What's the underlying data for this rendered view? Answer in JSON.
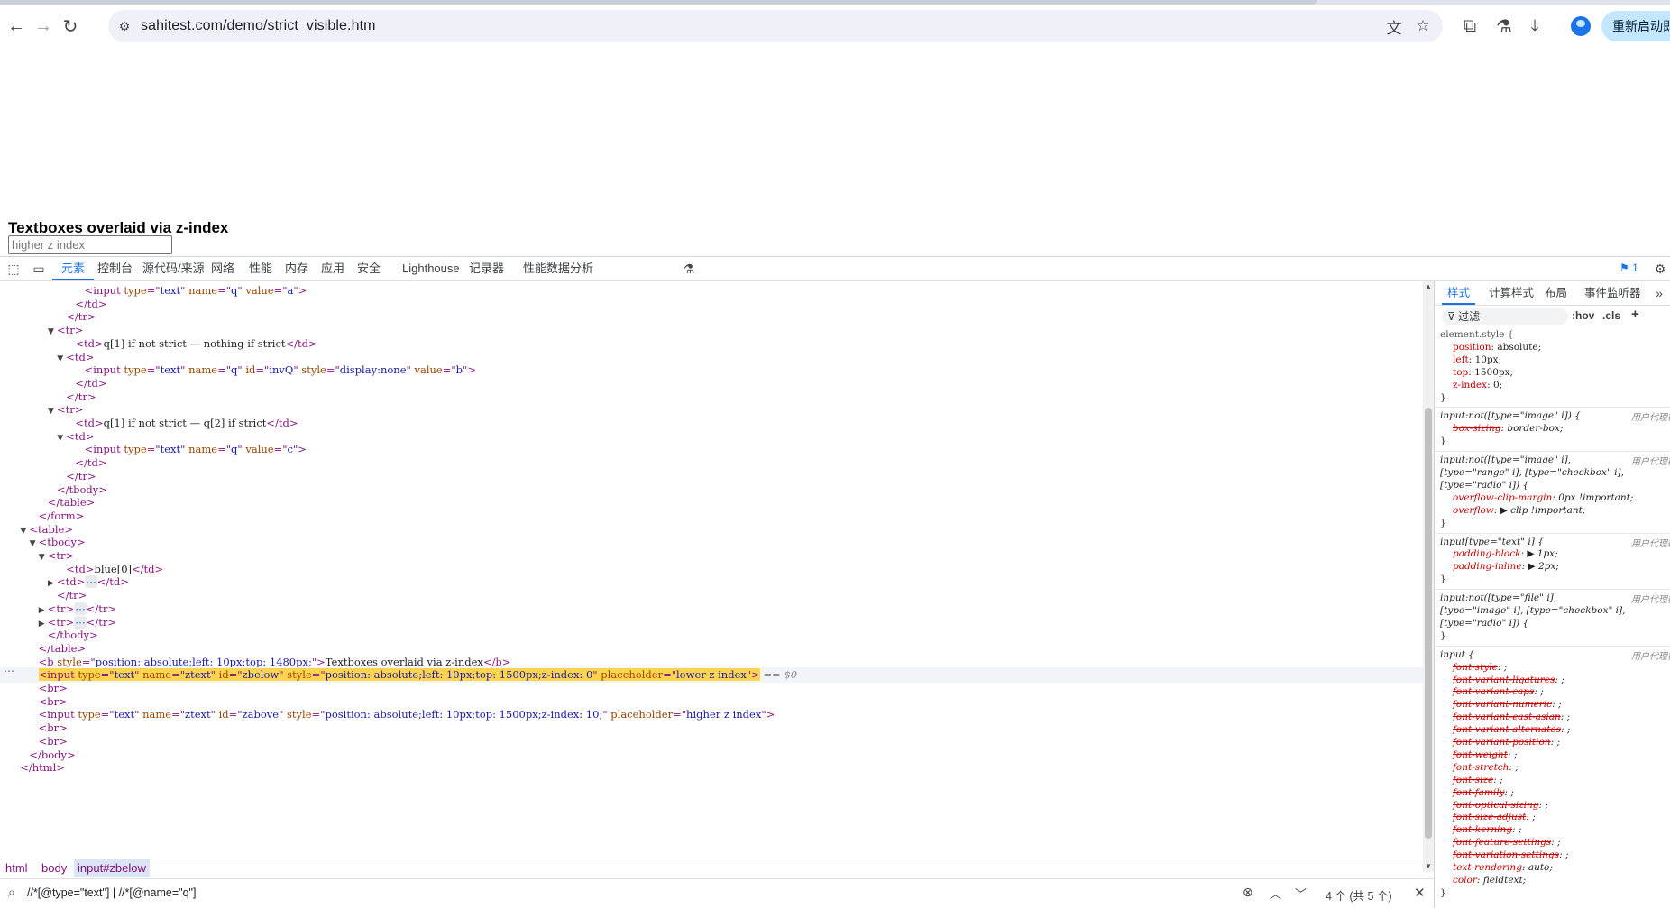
{
  "browser": {
    "url": "sahitest.com/demo/strict_visible.htm",
    "relaunch_label": "重新启动即可更新",
    "icons": {
      "back": "arrow-left-icon",
      "forward": "arrow-right-icon",
      "reload": "reload-icon",
      "site_info": "tune-icon",
      "translate": "translate-icon",
      "bookmark": "star-icon",
      "extensions": "puzzle-icon",
      "labs": "flask-icon",
      "downloads": "download-icon",
      "profile": "avatar-icon"
    }
  },
  "page": {
    "heading": "Textboxes overlaid via z-index",
    "input_placeholder": "higher z index"
  },
  "devtools": {
    "tabs": [
      "元素",
      "控制台",
      "源代码/来源",
      "网络",
      "性能",
      "内存",
      "应用",
      "安全",
      "Lighthouse",
      "记录器",
      "性能数据分析"
    ],
    "active_tab": "元素",
    "message_count": "1",
    "dom_lines": [
      {
        "indent": 8,
        "tri": "",
        "parts": [
          [
            "t",
            "<input "
          ],
          [
            "a",
            "type"
          ],
          [
            "t",
            "=\""
          ],
          [
            "v",
            "text"
          ],
          [
            "t",
            "\" "
          ],
          [
            "a",
            "name"
          ],
          [
            "t",
            "=\""
          ],
          [
            "v",
            "q"
          ],
          [
            "t",
            "\" "
          ],
          [
            "a",
            "value"
          ],
          [
            "t",
            "=\""
          ],
          [
            "v",
            "a"
          ],
          [
            "t",
            "\">"
          ]
        ]
      },
      {
        "indent": 7,
        "tri": "",
        "parts": [
          [
            "t",
            "</td>"
          ]
        ]
      },
      {
        "indent": 6,
        "tri": "",
        "parts": [
          [
            "t",
            "</tr>"
          ]
        ]
      },
      {
        "indent": 5,
        "tri": "▼",
        "parts": [
          [
            "t",
            "<tr>"
          ]
        ]
      },
      {
        "indent": 7,
        "tri": "",
        "parts": [
          [
            "t",
            "<td>"
          ],
          [
            "x",
            "q[1] if not strict — nothing if strict"
          ],
          [
            "t",
            "</td>"
          ]
        ]
      },
      {
        "indent": 6,
        "tri": "▼",
        "parts": [
          [
            "t",
            "<td>"
          ]
        ]
      },
      {
        "indent": 8,
        "tri": "",
        "parts": [
          [
            "t",
            "<input "
          ],
          [
            "a",
            "type"
          ],
          [
            "t",
            "=\""
          ],
          [
            "v",
            "text"
          ],
          [
            "t",
            "\" "
          ],
          [
            "a",
            "name"
          ],
          [
            "t",
            "=\""
          ],
          [
            "v",
            "q"
          ],
          [
            "t",
            "\" "
          ],
          [
            "a",
            "id"
          ],
          [
            "t",
            "=\""
          ],
          [
            "v",
            "invQ"
          ],
          [
            "t",
            "\" "
          ],
          [
            "a",
            "style"
          ],
          [
            "t",
            "=\""
          ],
          [
            "v",
            "display:none"
          ],
          [
            "t",
            "\" "
          ],
          [
            "a",
            "value"
          ],
          [
            "t",
            "=\""
          ],
          [
            "v",
            "b"
          ],
          [
            "t",
            "\">"
          ]
        ]
      },
      {
        "indent": 7,
        "tri": "",
        "parts": [
          [
            "t",
            "</td>"
          ]
        ]
      },
      {
        "indent": 6,
        "tri": "",
        "parts": [
          [
            "t",
            "</tr>"
          ]
        ]
      },
      {
        "indent": 5,
        "tri": "▼",
        "parts": [
          [
            "t",
            "<tr>"
          ]
        ]
      },
      {
        "indent": 7,
        "tri": "",
        "parts": [
          [
            "t",
            "<td>"
          ],
          [
            "x",
            "q[1] if not strict — q[2] if strict"
          ],
          [
            "t",
            "</td>"
          ]
        ]
      },
      {
        "indent": 6,
        "tri": "▼",
        "parts": [
          [
            "t",
            "<td>"
          ]
        ]
      },
      {
        "indent": 8,
        "tri": "",
        "parts": [
          [
            "t",
            "<input "
          ],
          [
            "a",
            "type"
          ],
          [
            "t",
            "=\""
          ],
          [
            "v",
            "text"
          ],
          [
            "t",
            "\" "
          ],
          [
            "a",
            "name"
          ],
          [
            "t",
            "=\""
          ],
          [
            "v",
            "q"
          ],
          [
            "t",
            "\" "
          ],
          [
            "a",
            "value"
          ],
          [
            "t",
            "=\""
          ],
          [
            "v",
            "c"
          ],
          [
            "t",
            "\">"
          ]
        ]
      },
      {
        "indent": 7,
        "tri": "",
        "parts": [
          [
            "t",
            "</td>"
          ]
        ]
      },
      {
        "indent": 6,
        "tri": "",
        "parts": [
          [
            "t",
            "</tr>"
          ]
        ]
      },
      {
        "indent": 5,
        "tri": "",
        "parts": [
          [
            "t",
            "</tbody>"
          ]
        ]
      },
      {
        "indent": 4,
        "tri": "",
        "parts": [
          [
            "t",
            "</table>"
          ]
        ]
      },
      {
        "indent": 3,
        "tri": "",
        "parts": [
          [
            "t",
            "</form>"
          ]
        ]
      },
      {
        "indent": 2,
        "tri": "▼",
        "parts": [
          [
            "t",
            "<table>"
          ]
        ]
      },
      {
        "indent": 3,
        "tri": "▼",
        "parts": [
          [
            "t",
            "<tbody>"
          ]
        ]
      },
      {
        "indent": 4,
        "tri": "▼",
        "parts": [
          [
            "t",
            "<tr>"
          ]
        ]
      },
      {
        "indent": 6,
        "tri": "",
        "parts": [
          [
            "t",
            "<td>"
          ],
          [
            "x",
            "blue[0]"
          ],
          [
            "t",
            "</td>"
          ]
        ]
      },
      {
        "indent": 5,
        "tri": "▶",
        "parts": [
          [
            "t",
            "<td>"
          ],
          [
            "e",
            "⋯"
          ],
          [
            "t",
            "</td>"
          ]
        ]
      },
      {
        "indent": 5,
        "tri": "",
        "parts": [
          [
            "t",
            "</tr>"
          ]
        ]
      },
      {
        "indent": 4,
        "tri": "▶",
        "parts": [
          [
            "t",
            "<tr>"
          ],
          [
            "e",
            "⋯"
          ],
          [
            "t",
            "</tr>"
          ]
        ]
      },
      {
        "indent": 4,
        "tri": "▶",
        "parts": [
          [
            "t",
            "<tr>"
          ],
          [
            "e",
            "⋯"
          ],
          [
            "t",
            "</tr>"
          ]
        ]
      },
      {
        "indent": 4,
        "tri": "",
        "parts": [
          [
            "t",
            "</tbody>"
          ]
        ]
      },
      {
        "indent": 3,
        "tri": "",
        "parts": [
          [
            "t",
            "</table>"
          ]
        ]
      },
      {
        "indent": 3,
        "tri": "",
        "parts": [
          [
            "t",
            "<b "
          ],
          [
            "a",
            "style"
          ],
          [
            "t",
            "=\""
          ],
          [
            "v",
            "position: absolute;left: 10px;top: 1480px;"
          ],
          [
            "t",
            "\">"
          ],
          [
            "x",
            "Textboxes overlaid via z-index"
          ],
          [
            "t",
            "</b>"
          ]
        ]
      },
      {
        "indent": 3,
        "tri": "",
        "selected": true,
        "parts": [
          [
            "t",
            "<input "
          ],
          [
            "a",
            "type"
          ],
          [
            "t",
            "=\""
          ],
          [
            "v",
            "text"
          ],
          [
            "t",
            "\" "
          ],
          [
            "a",
            "name"
          ],
          [
            "t",
            "=\""
          ],
          [
            "v",
            "ztext"
          ],
          [
            "t",
            "\" "
          ],
          [
            "a",
            "id"
          ],
          [
            "t",
            "=\""
          ],
          [
            "v",
            "zbelow"
          ],
          [
            "t",
            "\" "
          ],
          [
            "a",
            "style"
          ],
          [
            "t",
            "=\""
          ],
          [
            "v",
            "position: absolute;left: 10px;top: 1500px;z-index: 0"
          ],
          [
            "t",
            "\" "
          ],
          [
            "a",
            "placeholder"
          ],
          [
            "t",
            "=\""
          ],
          [
            "v",
            "lower z index"
          ],
          [
            "t",
            "\">"
          ]
        ]
      },
      {
        "indent": 3,
        "tri": "",
        "parts": [
          [
            "t",
            "<br>"
          ]
        ]
      },
      {
        "indent": 3,
        "tri": "",
        "parts": [
          [
            "t",
            "<br>"
          ]
        ]
      },
      {
        "indent": 3,
        "tri": "",
        "parts": [
          [
            "t",
            "<input "
          ],
          [
            "a",
            "type"
          ],
          [
            "t",
            "=\""
          ],
          [
            "v",
            "text"
          ],
          [
            "t",
            "\" "
          ],
          [
            "a",
            "name"
          ],
          [
            "t",
            "=\""
          ],
          [
            "v",
            "ztext"
          ],
          [
            "t",
            "\" "
          ],
          [
            "a",
            "id"
          ],
          [
            "t",
            "=\""
          ],
          [
            "v",
            "zabove"
          ],
          [
            "t",
            "\" "
          ],
          [
            "a",
            "style"
          ],
          [
            "t",
            "=\""
          ],
          [
            "v",
            "position: absolute;left: 10px;top: 1500px;z-index: 10;"
          ],
          [
            "t",
            "\" "
          ],
          [
            "a",
            "placeholder"
          ],
          [
            "t",
            "=\""
          ],
          [
            "v",
            "higher z index"
          ],
          [
            "t",
            "\">"
          ]
        ]
      },
      {
        "indent": 3,
        "tri": "",
        "parts": [
          [
            "t",
            "<br>"
          ]
        ]
      },
      {
        "indent": 3,
        "tri": "",
        "parts": [
          [
            "t",
            "<br>"
          ]
        ]
      },
      {
        "indent": 2,
        "tri": "",
        "parts": [
          [
            "t",
            "</body>"
          ]
        ]
      },
      {
        "indent": 1,
        "tri": "",
        "parts": [
          [
            "t",
            "</html>"
          ]
        ]
      }
    ],
    "selected_suffix": "== $0",
    "breadcrumbs": [
      "html",
      "body",
      "input#zbelow"
    ],
    "search_query": "//*[@type=\"text\"] | //*[@name=\"q\"]",
    "search_count": "4 个 (共 5 个)",
    "styles_tabs": [
      "样式",
      "计算样式",
      "布局",
      "事件监听器"
    ],
    "filter_label": "过滤",
    "filter_hov": ":hov",
    "filter_cls": ".cls",
    "user_agent_label": "用户代理样式表",
    "css_rules": [
      {
        "selector": "element.style {",
        "plain": true,
        "props": [
          [
            "position",
            "absolute;",
            false
          ],
          [
            "left",
            "10px;",
            false
          ],
          [
            "top",
            "1500px;",
            false
          ],
          [
            "z-index",
            "0;",
            false
          ]
        ],
        "origin": ""
      },
      {
        "selector": "input:not([type=\"image\" i]) {",
        "props": [
          [
            "box-sizing",
            "border-box;",
            true
          ]
        ],
        "origin": "ua"
      },
      {
        "selector": "input:not([type=\"image\" i],",
        "selector2": "[type=\"range\" i], [type=\"checkbox\" i],",
        "selector3": "[type=\"radio\" i]) {",
        "props": [
          [
            "overflow-clip-margin",
            "0px !important;",
            false
          ],
          [
            "overflow",
            "▶ clip !important;",
            false
          ]
        ],
        "origin": "ua"
      },
      {
        "selector": "input[type=\"text\" i] {",
        "props": [
          [
            "padding-block",
            "▶ 1px;",
            false
          ],
          [
            "padding-inline",
            "▶ 2px;",
            false
          ]
        ],
        "origin": "ua"
      },
      {
        "selector": "input:not([type=\"file\" i],",
        "selector2": "[type=\"image\" i], [type=\"checkbox\" i],",
        "selector3": "[type=\"radio\" i]) {",
        "props": [],
        "origin": "ua"
      },
      {
        "selector": "input {",
        "props": [
          [
            "font-style",
            ";",
            true
          ],
          [
            "font-variant-ligatures",
            ";",
            true
          ],
          [
            "font-variant-caps",
            ";",
            true
          ],
          [
            "font-variant-numeric",
            ";",
            true
          ],
          [
            "font-variant-east-asian",
            ";",
            true
          ],
          [
            "font-variant-alternates",
            ";",
            true
          ],
          [
            "font-variant-position",
            ";",
            true
          ],
          [
            "font-weight",
            ";",
            true
          ],
          [
            "font-stretch",
            ";",
            true
          ],
          [
            "font-size",
            ";",
            true
          ],
          [
            "font-family",
            ";",
            true
          ],
          [
            "font-optical-sizing",
            ";",
            true
          ],
          [
            "font-size-adjust",
            ";",
            true
          ],
          [
            "font-kerning",
            ";",
            true
          ],
          [
            "font-feature-settings",
            ";",
            true
          ],
          [
            "font-variation-settings",
            ";",
            true
          ],
          [
            "text-rendering",
            "auto;",
            false
          ],
          [
            "color",
            "fieldtext;",
            false
          ]
        ],
        "origin": "ua"
      }
    ]
  }
}
